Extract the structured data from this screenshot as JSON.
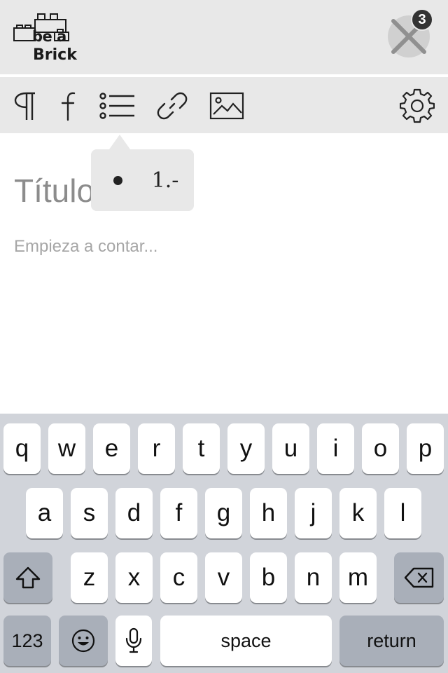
{
  "header": {
    "logo": {
      "line1": "be a",
      "line2": "Brick"
    },
    "close_icon": "close-icon",
    "badge_count": "3"
  },
  "toolbar": {
    "tools": [
      "paragraph-icon",
      "font-icon",
      "list-icon",
      "link-icon",
      "image-icon",
      "gear-icon"
    ]
  },
  "list_popover": {
    "bullet_icon": "bullet-list-icon",
    "numbered_label": "1.-"
  },
  "editor": {
    "title_placeholder": "Título",
    "body_placeholder": "Empieza a contar..."
  },
  "keyboard": {
    "row1": [
      "q",
      "w",
      "e",
      "r",
      "t",
      "y",
      "u",
      "i",
      "o",
      "p"
    ],
    "row2": [
      "a",
      "s",
      "d",
      "f",
      "g",
      "h",
      "j",
      "k",
      "l"
    ],
    "row3": [
      "z",
      "x",
      "c",
      "v",
      "b",
      "n",
      "m"
    ],
    "numbers_label": "123",
    "space_label": "space",
    "return_label": "return",
    "icons": [
      "shift-icon",
      "backspace-icon",
      "emoji-icon",
      "microphone-icon"
    ]
  },
  "colors": {
    "header_bg": "#e8e8e8",
    "keyboard_bg": "#d1d4da",
    "dark_key": "#a9afb9"
  }
}
